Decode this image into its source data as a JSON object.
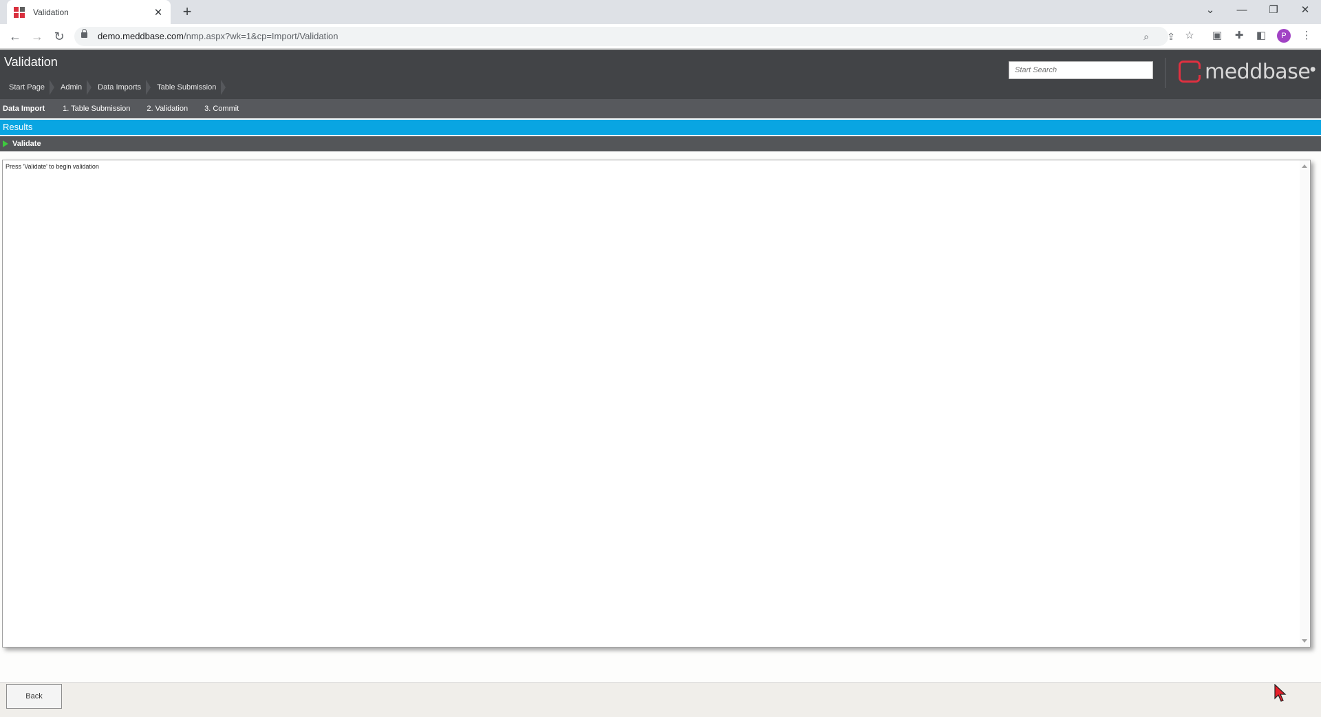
{
  "browser": {
    "tab_title": "Validation",
    "tab_close": "✕",
    "new_tab": "+",
    "url_host": "demo.meddbase.com",
    "url_path": "/nmp.aspx?wk=1&cp=Import/Validation",
    "profile_initial": "P"
  },
  "header": {
    "page_title": "Validation",
    "breadcrumbs": [
      "Start Page",
      "Admin",
      "Data Imports",
      "Table Submission"
    ],
    "search_placeholder": "Start Search",
    "logo_text": "meddbase"
  },
  "steps": {
    "head": "Data Import",
    "items": [
      "1. Table Submission",
      "2. Validation",
      "3. Commit"
    ]
  },
  "results_title": "Results",
  "action": {
    "label": "Validate"
  },
  "content": {
    "message": "Press 'Validate' to begin validation"
  },
  "footer": {
    "back_label": "Back"
  },
  "colors": {
    "header_bg": "#424447",
    "accent_blue": "#09a5e2",
    "brand_red": "#e03040",
    "play_green": "#3ec93e"
  }
}
